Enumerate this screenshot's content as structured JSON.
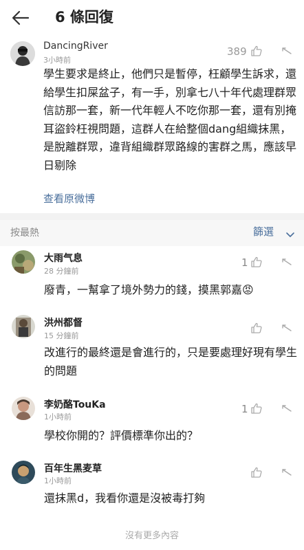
{
  "header": {
    "title": "6 條回復"
  },
  "main_post": {
    "username": "DancingRiver",
    "time": "3小時前",
    "likes": "389",
    "text": "學生要求是終止，他們只是暫停，枉顧學生訴求，還給學生扣屎盆子，有一手，別拿七八十年代處理群眾信訪那一套，新一代年輕人不吃你那一套，還有別掩耳盜鈴枉視問題，這群人在給整個dang組織抹黑，是脫離群眾，違背組織群眾路線的害群之馬，應該早日剔除",
    "view_original": "查看原微博"
  },
  "sort_bar": {
    "sort_label": "按最熱",
    "filter_label": "篩選"
  },
  "comments": [
    {
      "name": "大雨气息",
      "time": "28 分鐘前",
      "likes": "1",
      "text": "廢青，一幫拿了境外勢力的錢，摸黑郭嘉😡"
    },
    {
      "name": "洪州都督",
      "time": "15 分鐘前",
      "likes": "",
      "text": "改進行的最終還是會進行的，只是要處理好現有學生的問題"
    },
    {
      "name": "李奶酪TouKa",
      "time": "1小時前",
      "likes": "1",
      "text": "學校你開的？評價標準你出的？"
    },
    {
      "name": "百年生黑麦草",
      "time": "1小時前",
      "likes": "",
      "text": "還抹黑d，我看你還是沒被毒打夠"
    }
  ],
  "footer": {
    "end_text": "沒有更多內容"
  },
  "colors": {
    "link": "#4a6f9c",
    "muted": "#999999",
    "band": "#f2f2f2"
  }
}
